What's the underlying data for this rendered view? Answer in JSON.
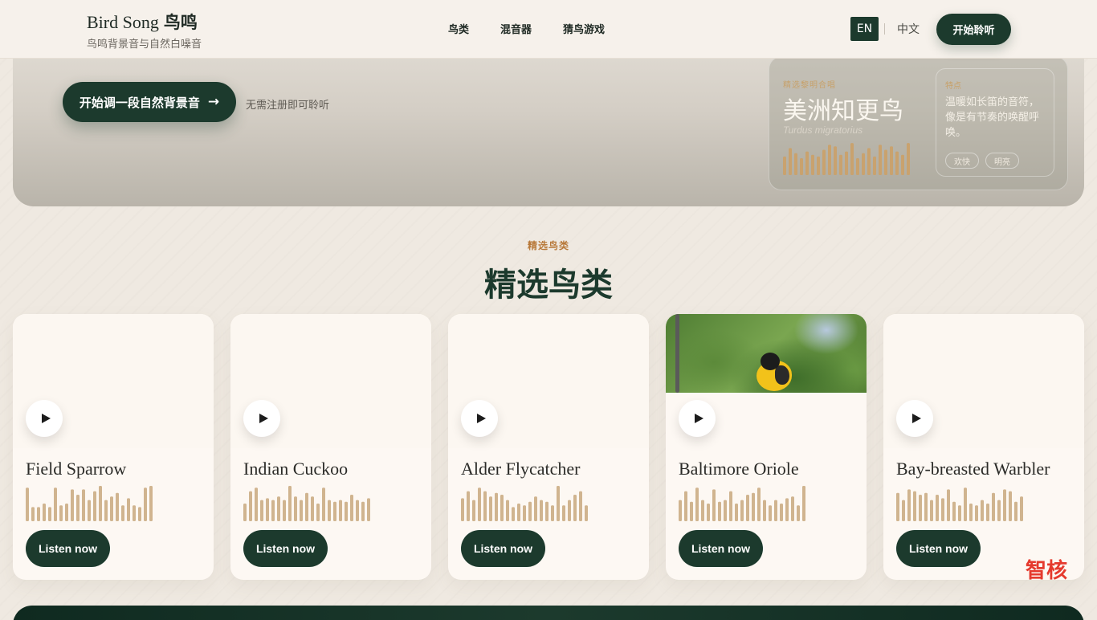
{
  "header": {
    "brand_en": "Bird Song",
    "brand_zh": "鸟鸣",
    "brand_sub": "鸟鸣背景音与自然白噪音",
    "nav": [
      "鸟类",
      "混音器",
      "猜鸟游戏"
    ],
    "lang_en": "EN",
    "lang_zh": "中文",
    "start_label": "开始聆听"
  },
  "hero": {
    "cta_label": "开始调一段自然背景音",
    "cta_arrow": "→",
    "note": "无需注册即可聆听",
    "featured": {
      "tag": "精选黎明合唱",
      "name": "美洲知更鸟",
      "latin": "Turdus migratorius",
      "side_label": "特点",
      "description": "温暖如长笛的音符，像是有节奏的唤醒呼唤。",
      "chips": [
        "欢快",
        "明亮"
      ],
      "wave_levels": [
        0.55,
        0.8,
        0.65,
        0.5,
        0.7,
        0.6,
        0.55,
        0.75,
        0.9,
        0.85,
        0.6,
        0.7,
        0.95,
        0.5,
        0.65,
        0.8,
        0.55,
        0.9,
        0.75,
        0.85,
        0.7,
        0.6,
        0.95
      ]
    }
  },
  "section": {
    "eyebrow": "精选鸟类",
    "title": "精选鸟类"
  },
  "cards": [
    {
      "name": "Field Sparrow",
      "listen_label": "Listen now",
      "has_photo": false,
      "wave_levels": [
        0.95,
        0.4,
        0.4,
        0.5,
        0.4,
        0.95,
        0.45,
        0.5,
        0.9,
        0.75,
        0.9,
        0.6,
        0.85,
        1.0,
        0.6,
        0.7,
        0.8,
        0.45,
        0.65,
        0.45,
        0.4,
        0.95,
        1.0
      ]
    },
    {
      "name": "Indian Cuckoo",
      "listen_label": "Listen now",
      "has_photo": false,
      "wave_levels": [
        0.5,
        0.85,
        0.95,
        0.6,
        0.65,
        0.6,
        0.7,
        0.6,
        1.0,
        0.7,
        0.6,
        0.8,
        0.7,
        0.5,
        0.95,
        0.6,
        0.55,
        0.6,
        0.55,
        0.75,
        0.6,
        0.55,
        0.65
      ]
    },
    {
      "name": "Alder Flycatcher",
      "listen_label": "Listen now",
      "has_photo": false,
      "wave_levels": [
        0.65,
        0.85,
        0.6,
        0.95,
        0.85,
        0.7,
        0.8,
        0.75,
        0.6,
        0.4,
        0.5,
        0.45,
        0.55,
        0.7,
        0.6,
        0.55,
        0.45,
        1.0,
        0.45,
        0.6,
        0.75,
        0.85,
        0.45,
        0.6
      ]
    },
    {
      "name": "Baltimore Oriole",
      "listen_label": "Listen now",
      "has_photo": true,
      "wave_levels": [
        0.6,
        0.85,
        0.55,
        0.95,
        0.6,
        0.5,
        0.9,
        0.55,
        0.6,
        0.85,
        0.5,
        0.6,
        0.75,
        0.8,
        0.95,
        0.6,
        0.45,
        0.6,
        0.5,
        0.65,
        0.7,
        0.45,
        1.0
      ]
    },
    {
      "name": "Bay-breasted Warbler",
      "listen_label": "Listen now",
      "has_photo": false,
      "wave_levels": [
        0.8,
        0.6,
        0.9,
        0.85,
        0.75,
        0.8,
        0.6,
        0.75,
        0.65,
        0.9,
        0.55,
        0.45,
        0.95,
        0.5,
        0.45,
        0.6,
        0.5,
        0.8,
        0.6,
        0.9,
        0.85,
        0.55,
        0.7,
        0.9
      ]
    }
  ],
  "watermark": "智核",
  "colors": {
    "accent_dark": "#1c3a2d",
    "wave": "#d0b48f",
    "wave_hero": "#c9a26e",
    "eyebrow": "#b8793a"
  }
}
